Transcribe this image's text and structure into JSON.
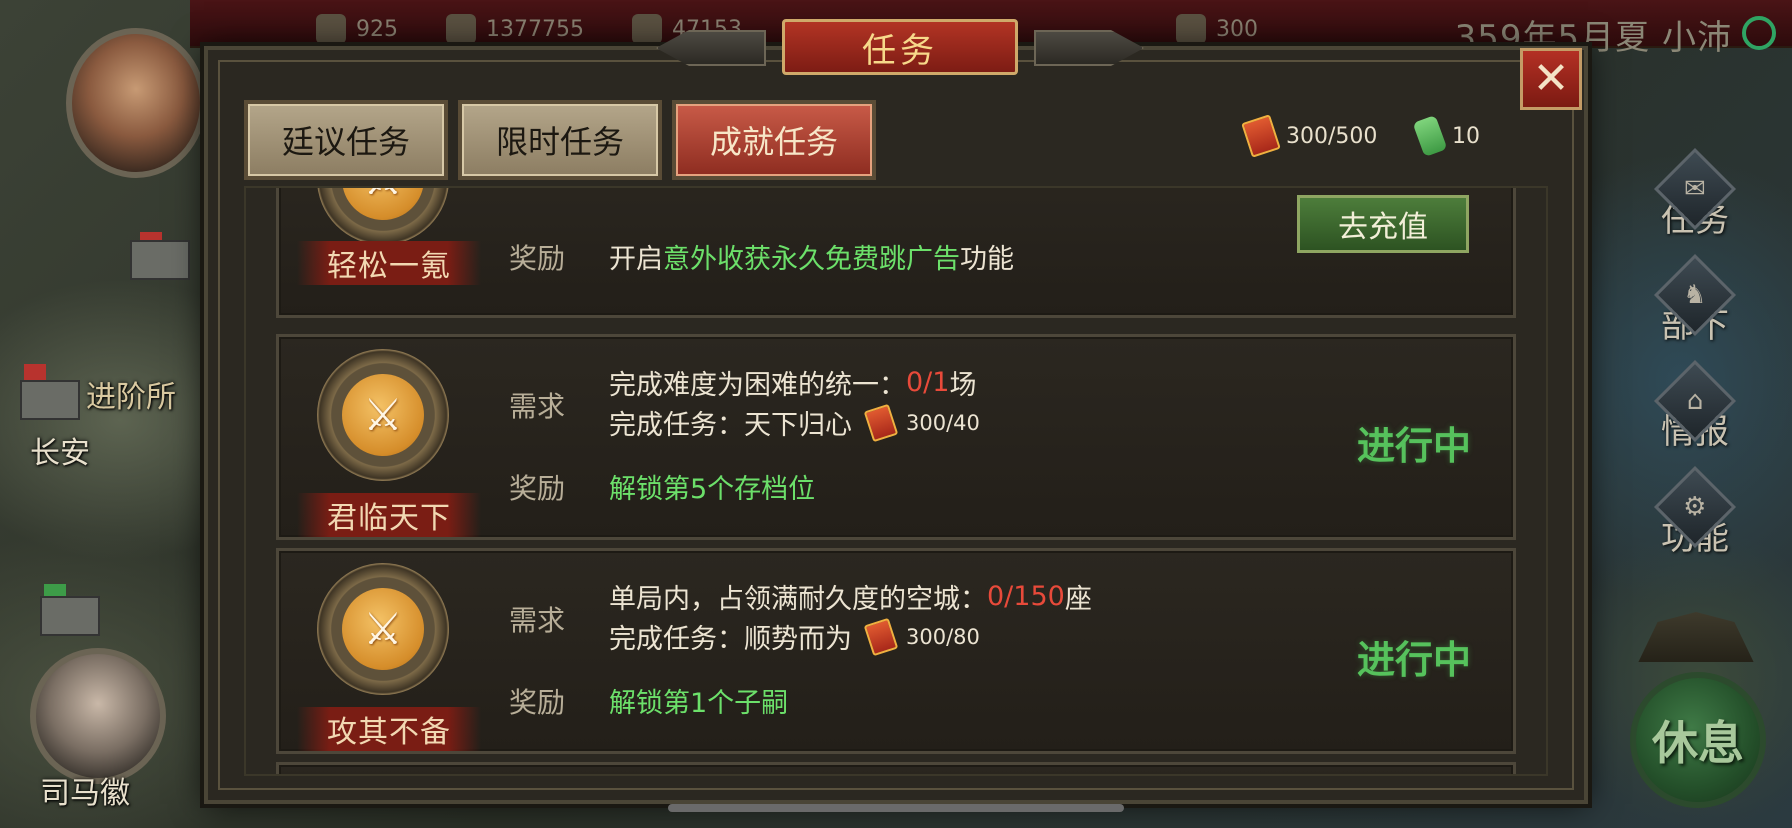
{
  "topbar": {
    "resources": [
      {
        "icon": "food-icon",
        "value": "925"
      },
      {
        "icon": "money-icon",
        "value": "1377755"
      },
      {
        "icon": "grain-icon",
        "value": "47153"
      },
      {
        "icon": "token-icon",
        "value": "300"
      }
    ],
    "date": "359年5月夏 小沛"
  },
  "map": {
    "cities": [
      "长安",
      "进阶所",
      "司马徽"
    ]
  },
  "side_nav": [
    {
      "label": "任务",
      "icon": "scroll-icon"
    },
    {
      "label": "部下",
      "icon": "soldier-icon"
    },
    {
      "label": "情报",
      "icon": "building-icon"
    },
    {
      "label": "功能",
      "icon": "gear-icon"
    }
  ],
  "rest_button": "休息",
  "dialog": {
    "title": "任务",
    "close": "✕",
    "tabs": [
      {
        "label": "廷议任务",
        "active": false
      },
      {
        "label": "限时任务",
        "active": false
      },
      {
        "label": "成就任务",
        "active": true
      }
    ],
    "currencies": [
      {
        "icon": "red-token-icon",
        "value": "300/500"
      },
      {
        "icon": "green-jade-icon",
        "value": "10"
      }
    ]
  },
  "tasks": [
    {
      "name": "轻松一氪",
      "reward_label": "奖励",
      "reward_prefix": "开启",
      "reward_highlight": "意外收获永久免费跳广告",
      "reward_suffix": "功能",
      "button": "去充值"
    },
    {
      "name": "君临天下",
      "req_label": "需求",
      "req1_prefix": "完成难度为困难的统一：",
      "req1_progress": "0/1",
      "req1_suffix": "场",
      "req2_prefix": "完成任务：天下归心",
      "req2_value": "300/40",
      "reward_label": "奖励",
      "reward": "解锁第5个存档位",
      "status": "进行中"
    },
    {
      "name": "攻其不备",
      "req_label": "需求",
      "req1_prefix": "单局内，占领满耐久度的空城：",
      "req1_progress": "0/150",
      "req1_suffix": "座",
      "req2_prefix": "完成任务：顺势而为",
      "req2_value": "300/80",
      "reward_label": "奖励",
      "reward": "解锁第1个子嗣",
      "status": "进行中"
    }
  ],
  "colors": {
    "accent_red": "#9c2a1e",
    "progress_red": "#e84a3a",
    "reward_green": "#6ce06a",
    "status_green": "#56c25c"
  }
}
